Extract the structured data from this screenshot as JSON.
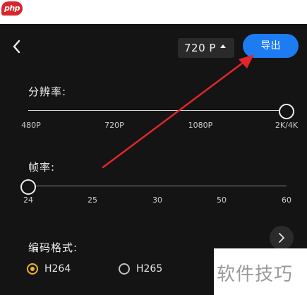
{
  "watermarks": {
    "top_logo": "php",
    "corner_text": "软件技巧"
  },
  "header": {
    "resolution_value": "720 P",
    "export_label": "导出"
  },
  "resolution": {
    "label": "分辨率:",
    "ticks": [
      "480P",
      "720P",
      "1080P",
      "2K/4K"
    ],
    "selected_fraction": 1.0
  },
  "frame_rate": {
    "label": "帧率:",
    "ticks": [
      "24",
      "25",
      "30",
      "50",
      "60"
    ],
    "selected_fraction": 0.0
  },
  "encoding": {
    "label": "编码格式:",
    "options": [
      {
        "label": "H264",
        "selected": true
      },
      {
        "label": "H265",
        "selected": false
      }
    ]
  },
  "colors": {
    "accent": "#1e7cf2",
    "radio_selected": "#f0b429",
    "annotation_arrow": "#e0262b"
  },
  "icons": {
    "back": "chevron-left-icon",
    "dropdown": "caret-up-icon",
    "side_panel": "chevron-right-icon"
  }
}
